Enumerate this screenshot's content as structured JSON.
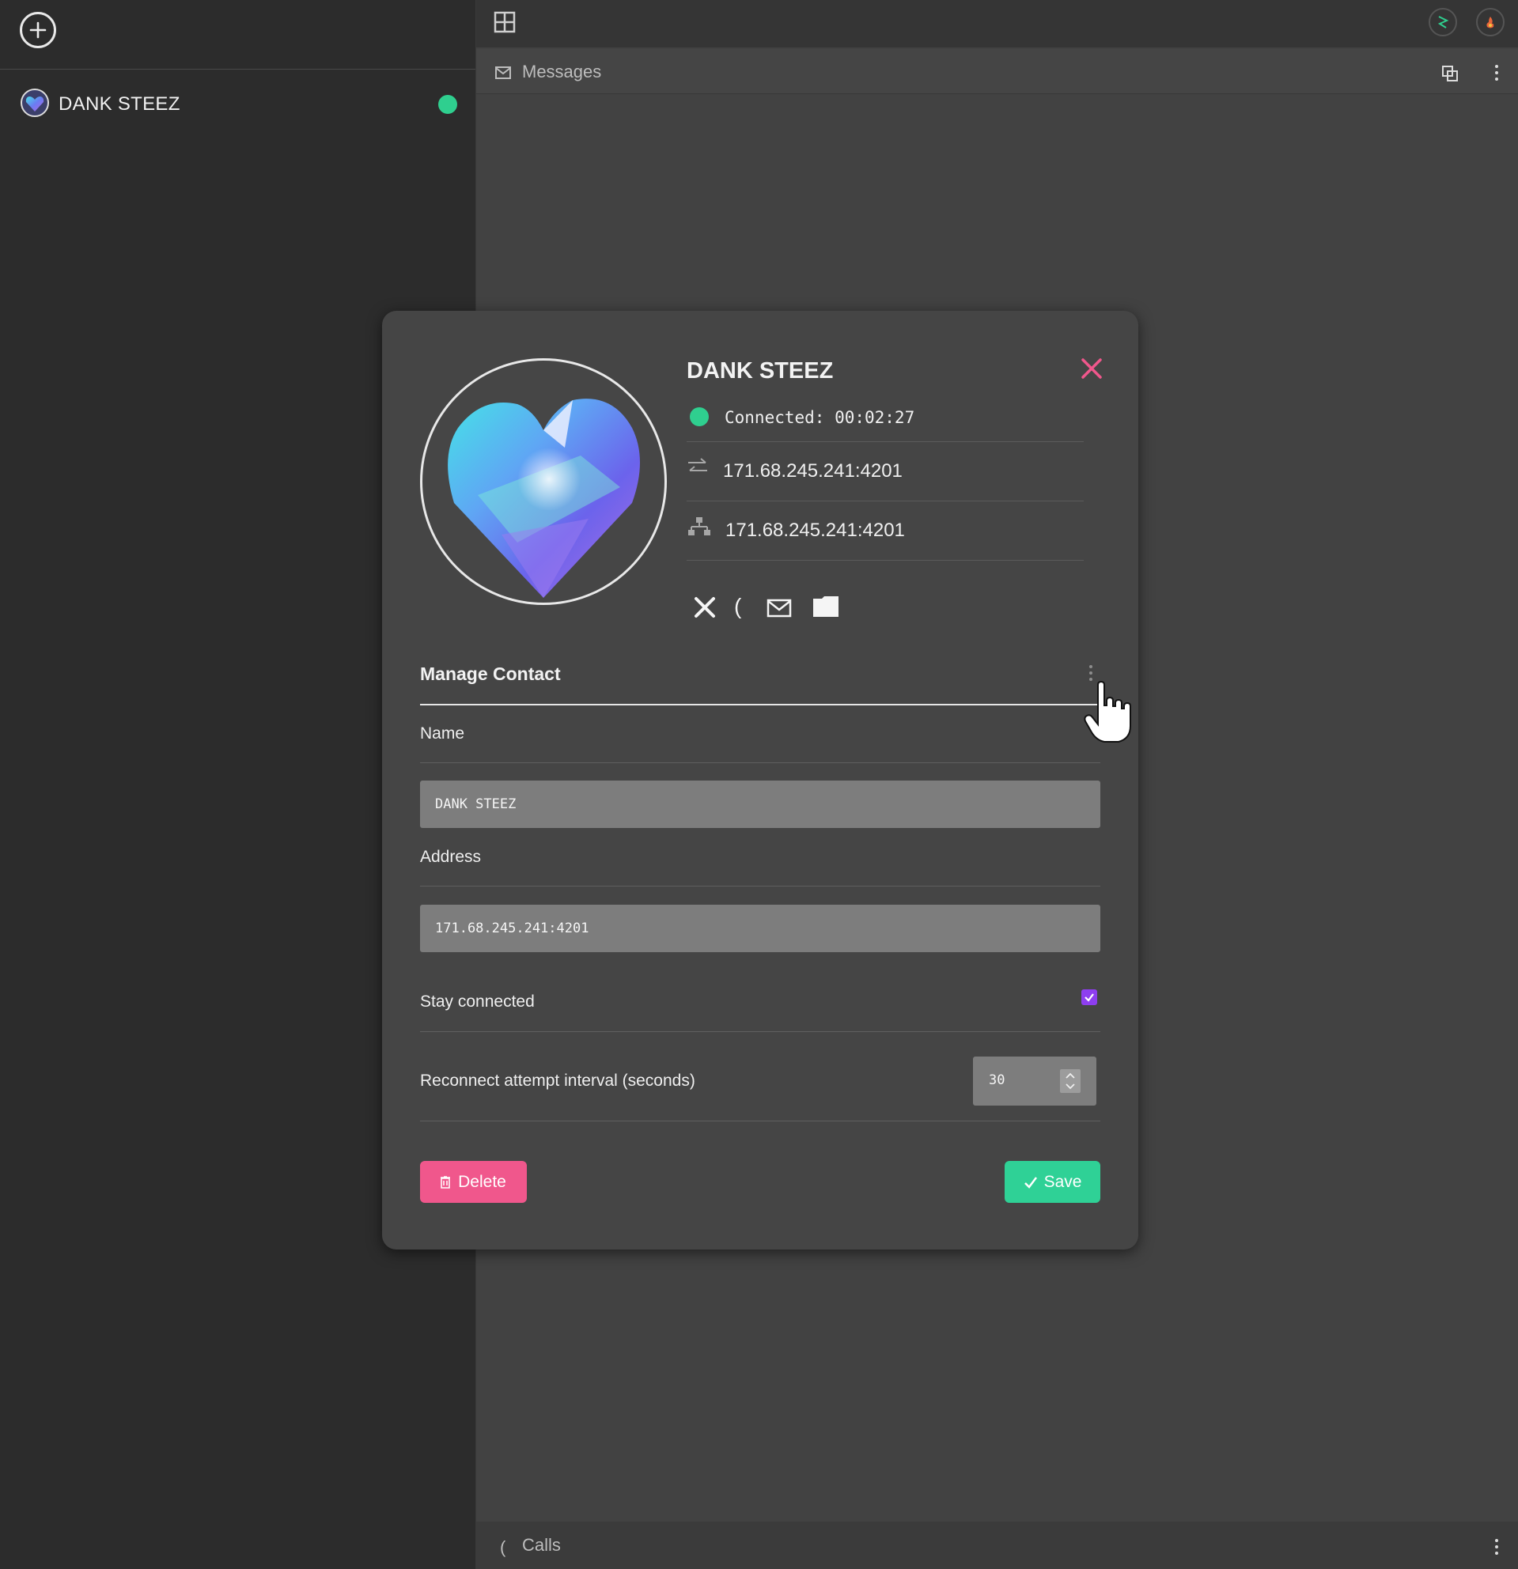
{
  "sidebar": {
    "contacts": [
      {
        "name": "DANK STEEZ",
        "status_color": "#2fcf8f"
      }
    ]
  },
  "main": {
    "messages_label": "Messages",
    "calls_label": "Calls"
  },
  "modal": {
    "title": "DANK STEEZ",
    "connection_status": "Connected: 00:02:27",
    "remote_address": "171.68.245.241:4201",
    "local_address": "171.68.245.241:4201",
    "section_title": "Manage Contact",
    "name_label": "Name",
    "name_value": "DANK STEEZ",
    "address_label": "Address",
    "address_value": "171.68.245.241:4201",
    "stay_connected_label": "Stay connected",
    "stay_connected": true,
    "reconnect_label": "Reconnect attempt interval (seconds)",
    "reconnect_value": "30",
    "delete_label": "Delete",
    "save_label": "Save"
  },
  "colors": {
    "online": "#2fcf8f",
    "danger": "#f0578c",
    "success": "#2fd196",
    "accent": "#8e3ef0"
  }
}
